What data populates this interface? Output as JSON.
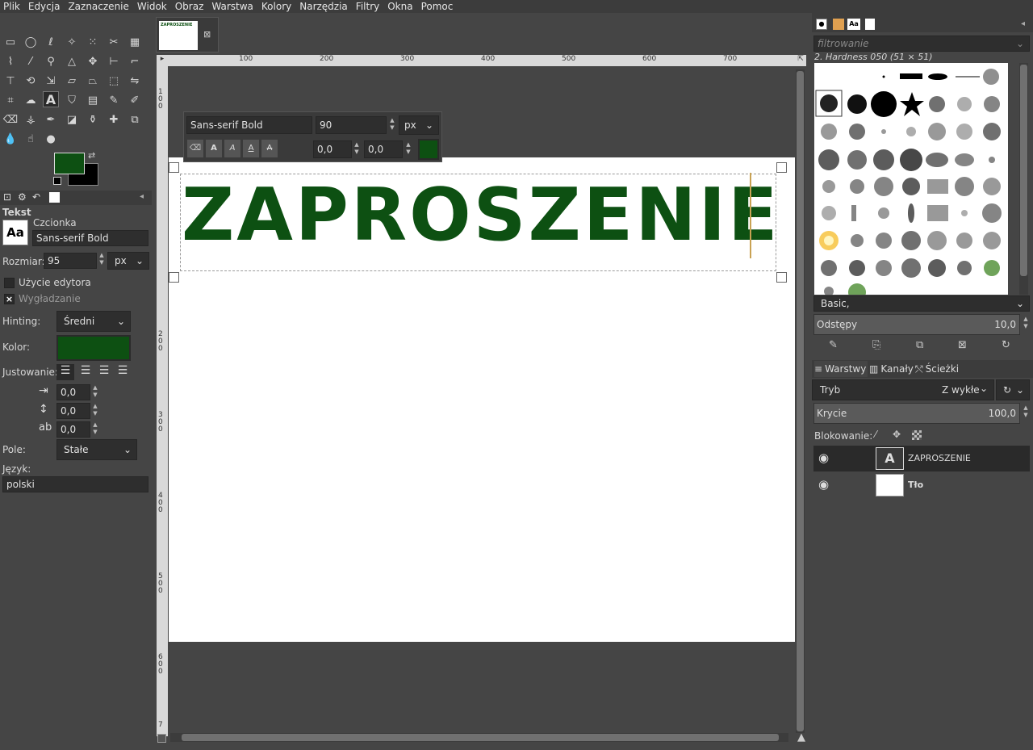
{
  "menu": [
    "Plik",
    "Edycja",
    "Zaznaczenie",
    "Widok",
    "Obraz",
    "Warstwa",
    "Kolory",
    "Narzędzia",
    "Filtry",
    "Okna",
    "Pomoc"
  ],
  "colors": {
    "foreground": "#0d5012",
    "background": "#000000",
    "text_color": "#0d5012"
  },
  "image_tab": {
    "thumbnail_text": "ZAPROSZENIE"
  },
  "tool_options": {
    "title": "Tekst",
    "font_label": "Czcionka",
    "font_value": "Sans-serif Bold",
    "font_preview": "Aa",
    "size_label": "Rozmiar:",
    "size_value": "95",
    "size_unit": "px",
    "use_editor": "Użycie edytora",
    "antialiasing": "Wygładzanie",
    "hinting_label": "Hinting:",
    "hinting_value": "Średni",
    "color_label": "Kolor:",
    "justify_label": "Justowanie:",
    "indent_value": "0,0",
    "line_spacing_value": "0,0",
    "letter_spacing_value": "0,0",
    "box_label": "Pole:",
    "box_value": "Stałe",
    "language_label": "Język:",
    "language_value": "polski"
  },
  "text_toolbar": {
    "font": "Sans-serif Bold",
    "size": "90",
    "unit": "px",
    "baseline": "0,0",
    "kerning": "0,0"
  },
  "canvas": {
    "text": "ZAPROSZENIE",
    "ruler_top": [
      "100",
      "200",
      "300",
      "400",
      "500",
      "600",
      "700"
    ],
    "ruler_left": [
      "100",
      "200",
      "300",
      "400",
      "500",
      "600",
      "7"
    ]
  },
  "brushes": {
    "filter_placeholder": "filtrowanie",
    "current_brush": "2. Hardness 050 (51 × 51)",
    "preset": "Basic,",
    "spacing_label": "Odstępy",
    "spacing_value": "10,0"
  },
  "layers": {
    "tabs": [
      "Warstwy",
      "Kanały",
      "Ścieżki"
    ],
    "mode_label": "Tryb",
    "mode_value": "Z wykłe",
    "opacity_label": "Krycie",
    "opacity_value": "100,0",
    "lock_label": "Blokowanie:",
    "items": [
      {
        "name": "ZAPROSZENIE"
      },
      {
        "name": "Tło"
      }
    ]
  }
}
